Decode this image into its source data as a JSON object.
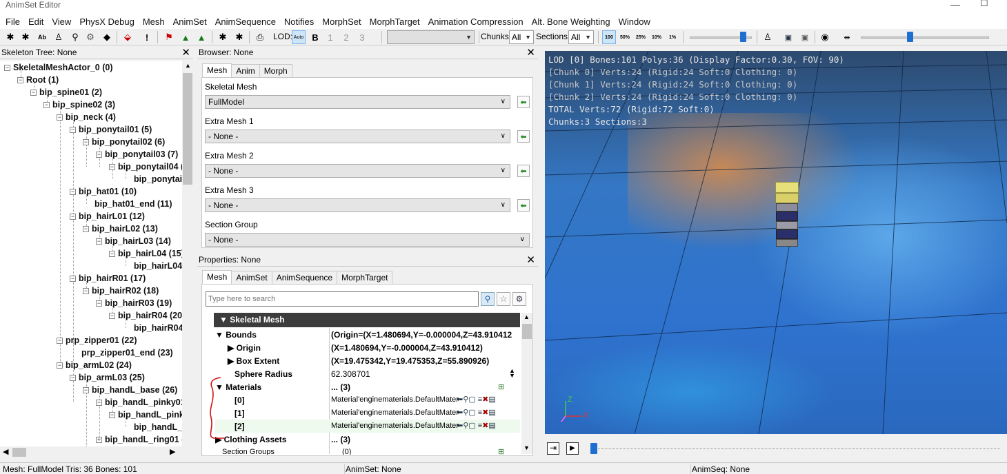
{
  "window": {
    "title": "AnimSet Editor"
  },
  "menu": [
    "File",
    "Edit",
    "View",
    "PhysX Debug",
    "Mesh",
    "AnimSet",
    "AnimSequence",
    "Notifies",
    "MorphSet",
    "MorphTarget",
    "Animation Compression",
    "Alt. Bone Weighting",
    "Window"
  ],
  "toolbar": {
    "lod_label": "LOD:",
    "lod_auto": "Auto",
    "lod_levels": [
      "B",
      "1",
      "2",
      "3"
    ],
    "chunks_label": "Chunks:",
    "chunks_value": "All",
    "sections_label": "Sections:",
    "sections_value": "All",
    "speeds": [
      "100",
      "50%",
      "25%",
      "10%",
      "1%"
    ],
    "slider1_value": 0.85,
    "slider2_value": 0.38
  },
  "skeleton_tree": {
    "title": "Skeleton Tree: None",
    "nodes": [
      "SkeletalMeshActor_0 (0)",
      "Root (1)",
      "bip_spine01 (2)",
      "bip_spine02 (3)",
      "bip_neck (4)",
      "bip_ponytail01 (5)",
      "bip_ponytail02 (6)",
      "bip_ponytail03 (7)",
      "bip_ponytail04 (",
      "bip_ponytail",
      "bip_hat01 (10)",
      "bip_hat01_end (11)",
      "bip_hairL01 (12)",
      "bip_hairL02 (13)",
      "bip_hairL03 (14)",
      "bip_hairL04 (15)",
      "bip_hairL04_",
      "bip_hairR01 (17)",
      "bip_hairR02 (18)",
      "bip_hairR03 (19)",
      "bip_hairR04 (20",
      "bip_hairR04_",
      "prp_zipper01 (22)",
      "prp_zipper01_end (23)",
      "bip_armL02 (24)",
      "bip_armL03 (25)",
      "bip_handL_base (26)",
      "bip_handL_pinky01",
      "bip_handL_pinky",
      "bip_handL_p",
      "bip_handL_ring01 ("
    ]
  },
  "browser": {
    "title": "Browser: None",
    "tabs": [
      "Mesh",
      "Anim",
      "Morph"
    ],
    "fields": [
      {
        "label": "Skeletal Mesh",
        "value": "FullModel"
      },
      {
        "label": "Extra Mesh 1",
        "value": "- None -"
      },
      {
        "label": "Extra Mesh 2",
        "value": "- None -"
      },
      {
        "label": "Extra Mesh 3",
        "value": "- None -"
      },
      {
        "label": "Section Group",
        "value": "- None -"
      }
    ]
  },
  "properties": {
    "title": "Properties: None",
    "tabs": [
      "Mesh",
      "AnimSet",
      "AnimSequence",
      "MorphTarget"
    ],
    "search_placeholder": "Type here to search",
    "category": "Skeletal Mesh",
    "rows": [
      {
        "key": "Bounds",
        "value": "(Origin=(X=1.480694,Y=-0.000004,Z=43.910412"
      },
      {
        "key": "Origin",
        "value": "(X=1.480694,Y=-0.000004,Z=43.910412)"
      },
      {
        "key": "Box Extent",
        "value": "(X=19.475342,Y=19.475353,Z=55.890926)"
      },
      {
        "key": "Sphere Radius",
        "value": "62.308701"
      },
      {
        "key": "Materials",
        "value": "... (3)"
      },
      {
        "key": "[0]",
        "value": "Material'enginematerials.DefaultMater"
      },
      {
        "key": "[1]",
        "value": "Material'enginematerials.DefaultMater"
      },
      {
        "key": "[2]",
        "value": "Material'enginematerials.DefaultMater"
      },
      {
        "key": "Clothing Assets",
        "value": "... (3)"
      },
      {
        "key": "Section Groups",
        "value": "(0)"
      }
    ]
  },
  "viewport": {
    "lines": [
      "LOD [0] Bones:101 Polys:36 (Display Factor:0.30, FOV: 90)",
      " [Chunk 0] Verts:24 (Rigid:24 Soft:0 Clothing: 0)",
      " [Chunk 1] Verts:24 (Rigid:24 Soft:0 Clothing: 0)",
      " [Chunk 2] Verts:24 (Rigid:24 Soft:0 Clothing: 0)",
      "TOTAL Verts:72 (Rigid:72 Soft:0)",
      "Chunks:3 Sections:3"
    ],
    "axes": {
      "z": "Z",
      "x": "X"
    },
    "timeline_value": 0.0
  },
  "status": {
    "mesh": "Mesh: FullModel  Tris: 36  Bones: 101",
    "animset": "AnimSet: None",
    "animseq": "AnimSeq: None"
  }
}
